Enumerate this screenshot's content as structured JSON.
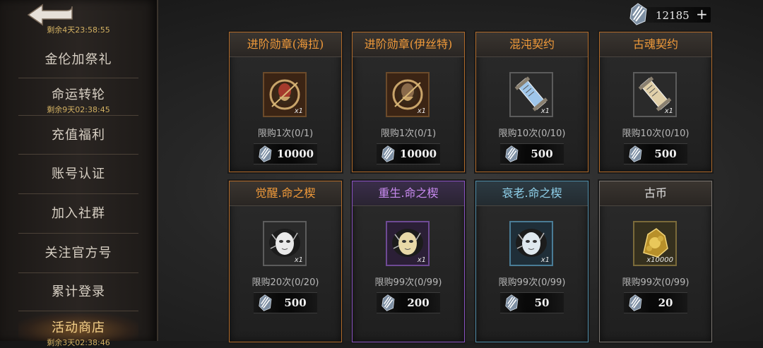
{
  "sidebar": {
    "back_timer": "剩余4天23:58:55",
    "items": [
      {
        "label": "金伦加祭礼",
        "sub": ""
      },
      {
        "label": "命运转轮",
        "sub": "剩余9天02:38:45"
      },
      {
        "label": "充值福利",
        "sub": ""
      },
      {
        "label": "账号认证",
        "sub": ""
      },
      {
        "label": "加入社群",
        "sub": ""
      },
      {
        "label": "关注官方号",
        "sub": ""
      },
      {
        "label": "累计登录",
        "sub": ""
      },
      {
        "label": "活动商店",
        "sub": "剩余3天02:38:46"
      }
    ]
  },
  "currency": {
    "amount": "12185",
    "plus": "+",
    "icon": "crystal-icon"
  },
  "shop": {
    "cards": [
      {
        "title": "进阶勋章(海拉)",
        "qty": "x1",
        "limit": "限购1次(0/1)",
        "price": "10000",
        "theme": "orange",
        "icon": "medal-icon"
      },
      {
        "title": "进阶勋章(伊丝特)",
        "qty": "x1",
        "limit": "限购1次(0/1)",
        "price": "10000",
        "theme": "orange",
        "icon": "medal-icon"
      },
      {
        "title": "混沌契约",
        "qty": "x1",
        "limit": "限购10次(0/10)",
        "price": "500",
        "theme": "orange",
        "icon": "contract-icon"
      },
      {
        "title": "古魂契约",
        "qty": "x1",
        "limit": "限购10次(0/10)",
        "price": "500",
        "theme": "orange",
        "icon": "contract-icon"
      },
      {
        "title": "觉醒.命之楔",
        "qty": "x1",
        "limit": "限购20次(0/20)",
        "price": "500",
        "theme": "orange",
        "icon": "mask-icon"
      },
      {
        "title": "重生.命之楔",
        "qty": "x1",
        "limit": "限购99次(0/99)",
        "price": "200",
        "theme": "purple",
        "icon": "mask-icon"
      },
      {
        "title": "衰老.命之楔",
        "qty": "x1",
        "limit": "限购99次(0/99)",
        "price": "50",
        "theme": "blue",
        "icon": "mask-icon"
      },
      {
        "title": "古币",
        "qty": "x10000",
        "limit": "限购99次(0/99)",
        "price": "20",
        "theme": "gray",
        "icon": "coin-icon"
      }
    ]
  }
}
